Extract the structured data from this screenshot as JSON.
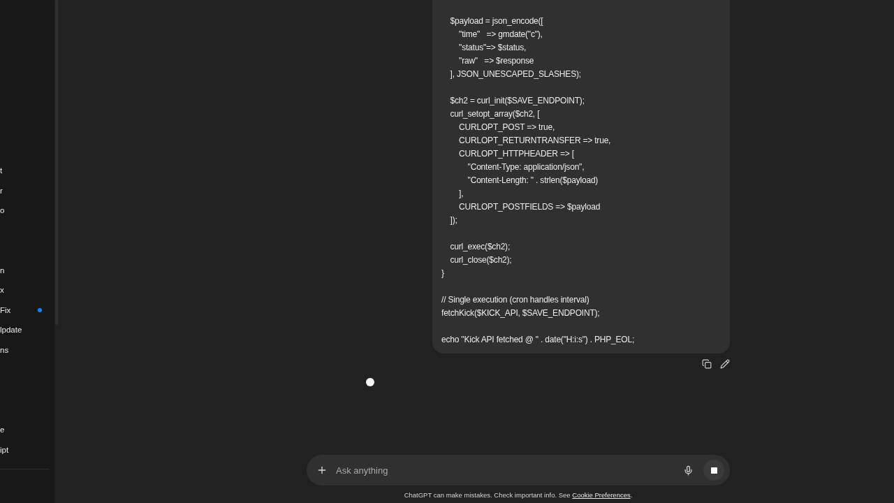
{
  "sidebar": {
    "items": [
      {
        "label": "t",
        "unread": false
      },
      {
        "label": "r",
        "unread": false
      },
      {
        "label": "o",
        "unread": false
      },
      {
        "label": "n",
        "unread": false
      },
      {
        "label": "x",
        "unread": false
      },
      {
        "label": "Fix",
        "unread": true
      },
      {
        "label": "lpdate",
        "unread": false
      },
      {
        "label": "ns",
        "unread": false
      },
      {
        "label": "e",
        "unread": false
      },
      {
        "label": "ipt",
        "unread": false
      }
    ]
  },
  "message": {
    "code_blocks": [
      [
        "    $payload = json_encode([",
        "        \"time\"   => gmdate(\"c\"),",
        "        \"status\"=> $status,",
        "        \"raw\"   => $response",
        "    ], JSON_UNESCAPED_SLASHES);"
      ],
      [
        "    $ch2 = curl_init($SAVE_ENDPOINT);",
        "    curl_setopt_array($ch2, [",
        "        CURLOPT_POST => true,",
        "        CURLOPT_RETURNTRANSFER => true,",
        "        CURLOPT_HTTPHEADER => [",
        "            \"Content-Type: application/json\",",
        "            \"Content-Length: \" . strlen($payload)",
        "        ],",
        "        CURLOPT_POSTFIELDS => $payload",
        "    ]);"
      ],
      [
        "    curl_exec($ch2);",
        "    curl_close($ch2);",
        "}"
      ],
      [
        "// Single execution (cron handles interval)",
        "fetchKick($KICK_API, $SAVE_ENDPOINT);"
      ],
      [
        "echo \"Kick API fetched @ \" . date(\"H:i:s\") . PHP_EOL;"
      ]
    ]
  },
  "composer": {
    "placeholder": "Ask anything"
  },
  "footer": {
    "text": "ChatGPT can make mistakes. Check important info. See",
    "link": "Cookie Preferences",
    "tail": "."
  }
}
